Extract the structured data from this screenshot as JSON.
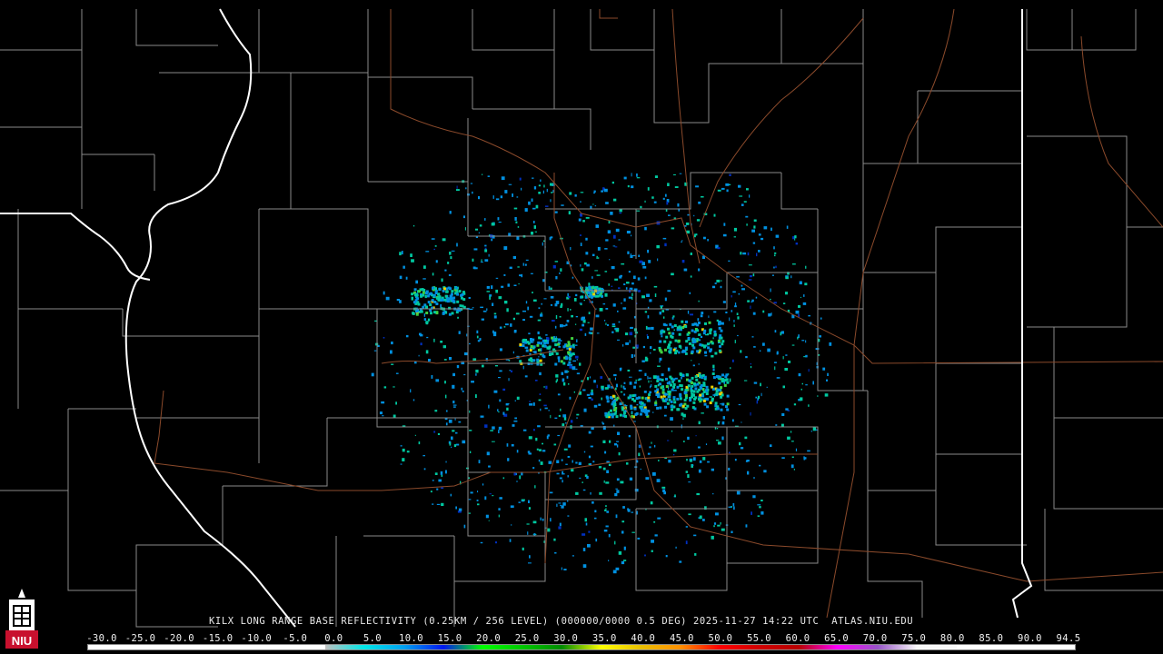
{
  "caption": "KILX LONG RANGE BASE REFLECTIVITY (0.25KM / 256 LEVEL) (000000/0000 0.5 DEG) 2025-11-27 14:22 UTC  ATLAS.NIU.EDU",
  "logo": {
    "text": "NIU",
    "icon": "niu-tower-logo-icon",
    "color": "#c8102e"
  },
  "scale": {
    "labels": [
      "-30.0",
      "-25.0",
      "-20.0",
      "-15.0",
      "-10.0",
      "-5.0",
      "0.0",
      "5.0",
      "10.0",
      "15.0",
      "20.0",
      "25.0",
      "30.0",
      "35.0",
      "40.0",
      "45.0",
      "50.0",
      "55.0",
      "60.0",
      "65.0",
      "70.0",
      "75.0",
      "80.0",
      "85.0",
      "90.0",
      "94.5"
    ],
    "colors": [
      "#ffffff",
      "#ffffff",
      "#ffffff",
      "#ffffff",
      "#ffffff",
      "#ffffff",
      "#c8c8c8",
      "#00e8e8",
      "#00a0f0",
      "#0018f0",
      "#00ff00",
      "#00c800",
      "#008c00",
      "#ffff00",
      "#e8c000",
      "#ff9000",
      "#ff0000",
      "#d00000",
      "#b80000",
      "#ff00ff",
      "#9855c8",
      "#f8f8f8",
      "#ffffff",
      "#ffffff",
      "#ffffff"
    ]
  },
  "map_colors": {
    "county_lines": "#909090",
    "state_lines": "#ffffff",
    "highways": "#8b4a2b",
    "echo_low": "#0090e0",
    "echo_mid": "#00c8a0",
    "echo_high": "#e8d000"
  }
}
